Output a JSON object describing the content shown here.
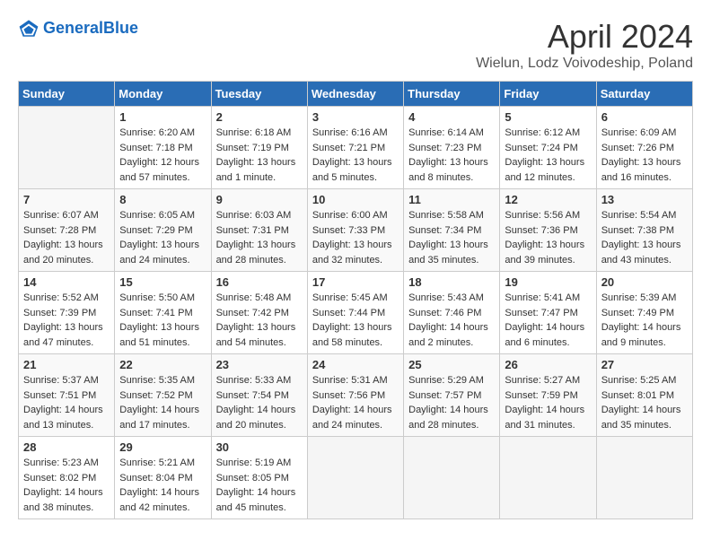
{
  "app": {
    "name": "GeneralBlue",
    "name_part1": "General",
    "name_part2": "Blue"
  },
  "title": "April 2024",
  "location": "Wielun, Lodz Voivodeship, Poland",
  "days_of_week": [
    "Sunday",
    "Monday",
    "Tuesday",
    "Wednesday",
    "Thursday",
    "Friday",
    "Saturday"
  ],
  "weeks": [
    [
      {
        "day": "",
        "sunrise": "",
        "sunset": "",
        "daylight": ""
      },
      {
        "day": "1",
        "sunrise": "Sunrise: 6:20 AM",
        "sunset": "Sunset: 7:18 PM",
        "daylight": "Daylight: 12 hours and 57 minutes."
      },
      {
        "day": "2",
        "sunrise": "Sunrise: 6:18 AM",
        "sunset": "Sunset: 7:19 PM",
        "daylight": "Daylight: 13 hours and 1 minute."
      },
      {
        "day": "3",
        "sunrise": "Sunrise: 6:16 AM",
        "sunset": "Sunset: 7:21 PM",
        "daylight": "Daylight: 13 hours and 5 minutes."
      },
      {
        "day": "4",
        "sunrise": "Sunrise: 6:14 AM",
        "sunset": "Sunset: 7:23 PM",
        "daylight": "Daylight: 13 hours and 8 minutes."
      },
      {
        "day": "5",
        "sunrise": "Sunrise: 6:12 AM",
        "sunset": "Sunset: 7:24 PM",
        "daylight": "Daylight: 13 hours and 12 minutes."
      },
      {
        "day": "6",
        "sunrise": "Sunrise: 6:09 AM",
        "sunset": "Sunset: 7:26 PM",
        "daylight": "Daylight: 13 hours and 16 minutes."
      }
    ],
    [
      {
        "day": "7",
        "sunrise": "Sunrise: 6:07 AM",
        "sunset": "Sunset: 7:28 PM",
        "daylight": "Daylight: 13 hours and 20 minutes."
      },
      {
        "day": "8",
        "sunrise": "Sunrise: 6:05 AM",
        "sunset": "Sunset: 7:29 PM",
        "daylight": "Daylight: 13 hours and 24 minutes."
      },
      {
        "day": "9",
        "sunrise": "Sunrise: 6:03 AM",
        "sunset": "Sunset: 7:31 PM",
        "daylight": "Daylight: 13 hours and 28 minutes."
      },
      {
        "day": "10",
        "sunrise": "Sunrise: 6:00 AM",
        "sunset": "Sunset: 7:33 PM",
        "daylight": "Daylight: 13 hours and 32 minutes."
      },
      {
        "day": "11",
        "sunrise": "Sunrise: 5:58 AM",
        "sunset": "Sunset: 7:34 PM",
        "daylight": "Daylight: 13 hours and 35 minutes."
      },
      {
        "day": "12",
        "sunrise": "Sunrise: 5:56 AM",
        "sunset": "Sunset: 7:36 PM",
        "daylight": "Daylight: 13 hours and 39 minutes."
      },
      {
        "day": "13",
        "sunrise": "Sunrise: 5:54 AM",
        "sunset": "Sunset: 7:38 PM",
        "daylight": "Daylight: 13 hours and 43 minutes."
      }
    ],
    [
      {
        "day": "14",
        "sunrise": "Sunrise: 5:52 AM",
        "sunset": "Sunset: 7:39 PM",
        "daylight": "Daylight: 13 hours and 47 minutes."
      },
      {
        "day": "15",
        "sunrise": "Sunrise: 5:50 AM",
        "sunset": "Sunset: 7:41 PM",
        "daylight": "Daylight: 13 hours and 51 minutes."
      },
      {
        "day": "16",
        "sunrise": "Sunrise: 5:48 AM",
        "sunset": "Sunset: 7:42 PM",
        "daylight": "Daylight: 13 hours and 54 minutes."
      },
      {
        "day": "17",
        "sunrise": "Sunrise: 5:45 AM",
        "sunset": "Sunset: 7:44 PM",
        "daylight": "Daylight: 13 hours and 58 minutes."
      },
      {
        "day": "18",
        "sunrise": "Sunrise: 5:43 AM",
        "sunset": "Sunset: 7:46 PM",
        "daylight": "Daylight: 14 hours and 2 minutes."
      },
      {
        "day": "19",
        "sunrise": "Sunrise: 5:41 AM",
        "sunset": "Sunset: 7:47 PM",
        "daylight": "Daylight: 14 hours and 6 minutes."
      },
      {
        "day": "20",
        "sunrise": "Sunrise: 5:39 AM",
        "sunset": "Sunset: 7:49 PM",
        "daylight": "Daylight: 14 hours and 9 minutes."
      }
    ],
    [
      {
        "day": "21",
        "sunrise": "Sunrise: 5:37 AM",
        "sunset": "Sunset: 7:51 PM",
        "daylight": "Daylight: 14 hours and 13 minutes."
      },
      {
        "day": "22",
        "sunrise": "Sunrise: 5:35 AM",
        "sunset": "Sunset: 7:52 PM",
        "daylight": "Daylight: 14 hours and 17 minutes."
      },
      {
        "day": "23",
        "sunrise": "Sunrise: 5:33 AM",
        "sunset": "Sunset: 7:54 PM",
        "daylight": "Daylight: 14 hours and 20 minutes."
      },
      {
        "day": "24",
        "sunrise": "Sunrise: 5:31 AM",
        "sunset": "Sunset: 7:56 PM",
        "daylight": "Daylight: 14 hours and 24 minutes."
      },
      {
        "day": "25",
        "sunrise": "Sunrise: 5:29 AM",
        "sunset": "Sunset: 7:57 PM",
        "daylight": "Daylight: 14 hours and 28 minutes."
      },
      {
        "day": "26",
        "sunrise": "Sunrise: 5:27 AM",
        "sunset": "Sunset: 7:59 PM",
        "daylight": "Daylight: 14 hours and 31 minutes."
      },
      {
        "day": "27",
        "sunrise": "Sunrise: 5:25 AM",
        "sunset": "Sunset: 8:01 PM",
        "daylight": "Daylight: 14 hours and 35 minutes."
      }
    ],
    [
      {
        "day": "28",
        "sunrise": "Sunrise: 5:23 AM",
        "sunset": "Sunset: 8:02 PM",
        "daylight": "Daylight: 14 hours and 38 minutes."
      },
      {
        "day": "29",
        "sunrise": "Sunrise: 5:21 AM",
        "sunset": "Sunset: 8:04 PM",
        "daylight": "Daylight: 14 hours and 42 minutes."
      },
      {
        "day": "30",
        "sunrise": "Sunrise: 5:19 AM",
        "sunset": "Sunset: 8:05 PM",
        "daylight": "Daylight: 14 hours and 45 minutes."
      },
      {
        "day": "",
        "sunrise": "",
        "sunset": "",
        "daylight": ""
      },
      {
        "day": "",
        "sunrise": "",
        "sunset": "",
        "daylight": ""
      },
      {
        "day": "",
        "sunrise": "",
        "sunset": "",
        "daylight": ""
      },
      {
        "day": "",
        "sunrise": "",
        "sunset": "",
        "daylight": ""
      }
    ]
  ]
}
